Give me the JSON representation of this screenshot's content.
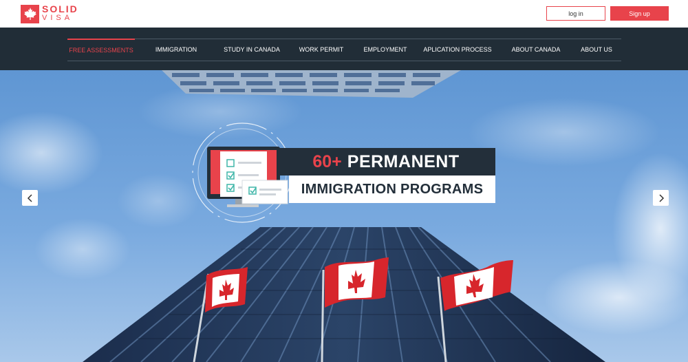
{
  "brand": {
    "name_line1": "SOLID",
    "name_line2": "VISA",
    "color": "#e8434b"
  },
  "auth": {
    "login_label": "log in",
    "signup_label": "Sign up"
  },
  "nav": {
    "items": [
      {
        "label": "FREE ASSESSMENTS",
        "active": true
      },
      {
        "label": "IMMIGRATION",
        "active": false
      },
      {
        "label": "STUDY IN CANADA",
        "active": false
      },
      {
        "label": "WORK PERMIT",
        "active": false
      },
      {
        "label": "EMPLOYMENT",
        "active": false
      },
      {
        "label": "APLICATION PROCESS",
        "active": false
      },
      {
        "label": "ABOUT CANADA",
        "active": false
      },
      {
        "label": "ABOUT US",
        "active": false
      }
    ],
    "background": "#212d37",
    "active_color": "#e8434b"
  },
  "hero": {
    "headline_number": "60+",
    "headline_text": "PERMANENT",
    "subheadline": "IMMIGRATION PROGRAMS",
    "prev_icon": "chevron-left-icon",
    "next_icon": "chevron-right-icon",
    "flag_icon": "canada-flag-icon"
  }
}
